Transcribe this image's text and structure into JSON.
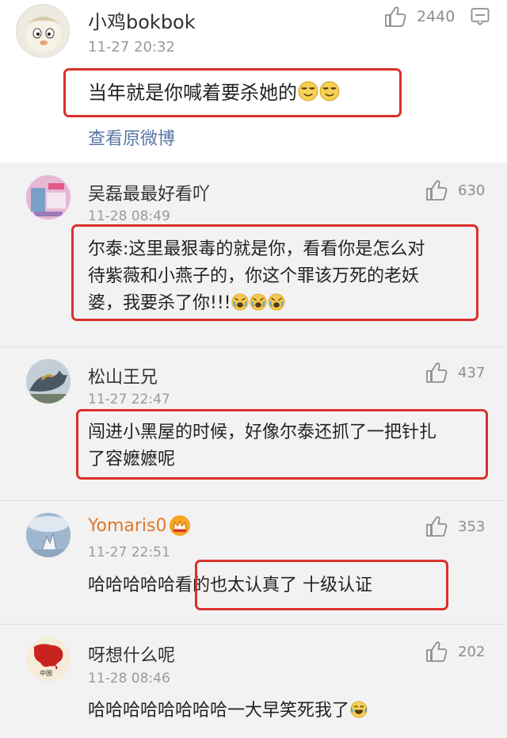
{
  "main_comment": {
    "username": "小鸡bokbok",
    "time": "11-27 20:32",
    "likes": "2440",
    "text": "当年就是你喊着要杀她的",
    "view_original": "查看原微博"
  },
  "replies": [
    {
      "username": "吴磊最最好看吖",
      "time": "11-28 08:49",
      "likes": "630",
      "text_line1": "尔泰:这里最狠毒的就是你，看看你是怎么对",
      "text_line2": "待紫薇和小燕子的，你这个罪该万死的老妖",
      "text_line3": "婆，我要杀了你!!!"
    },
    {
      "username": "松山王兄",
      "time": "11-27 22:47",
      "likes": "437",
      "text_line1": "闯进小黑屋的时候，好像尔泰还抓了一把针扎",
      "text_line2": "了容嬷嬷呢"
    },
    {
      "username": "Yomaris0",
      "time": "11-27 22:51",
      "likes": "353",
      "text": "哈哈哈哈哈看的也太认真了 十级认证",
      "name_color": "#e0782c"
    },
    {
      "username": "呀想什么呢",
      "time": "11-28 08:46",
      "likes": "202",
      "text": "哈哈哈哈哈哈哈哈一大早笑死我了",
      "avatar_caption": "中国"
    }
  ],
  "icons": {
    "like": "thumbs-up-icon",
    "comment": "comment-icon",
    "emoji_smirk": "smirk-emoji-icon",
    "emoji_cry": "crying-emoji-icon",
    "emoji_laugh": "laughing-emoji-icon",
    "vip_crown": "crown-badge-icon"
  },
  "colors": {
    "highlight": "#d9302c",
    "link": "#5a76a6",
    "reply_bg": "#f2f2f2"
  }
}
